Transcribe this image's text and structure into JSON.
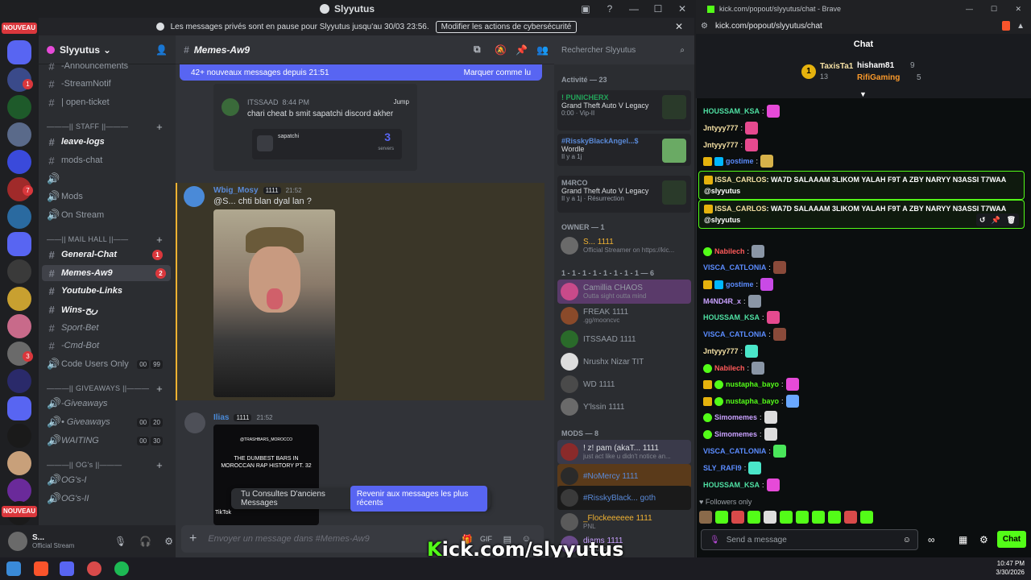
{
  "discord": {
    "window_title": "Slyyutus",
    "banner": {
      "text": "Les messages privés sont en pause pour Slyyutus jusqu'au 30/03 23:56.",
      "button": "Modifier les actions de cybersécurité"
    },
    "server_name": "Slyyutus",
    "guild_badges": {
      "new_top": "NOUVEAU",
      "new_bottom": "NOUVEAU"
    },
    "guild_counts": [
      "1",
      "7",
      "3"
    ],
    "channels": [
      {
        "label": "-Announcements",
        "type": "ch"
      },
      {
        "label": "-StreamNotif",
        "type": "ch"
      },
      {
        "label": "| open-ticket",
        "type": "ch"
      },
      {
        "label": "———|| STAFF ||———",
        "type": "cat"
      },
      {
        "label": "leave-logs",
        "type": "bold"
      },
      {
        "label": "mods-chat",
        "type": "ch"
      },
      {
        "label": "",
        "type": "ch"
      },
      {
        "label": "Mods",
        "type": "ch"
      },
      {
        "label": "On Stream",
        "type": "ch"
      },
      {
        "label": "——|| MAIL HALL ||——",
        "type": "cat"
      },
      {
        "label": "General-Chat",
        "type": "bold",
        "badge": "1"
      },
      {
        "label": "Memes-Aw9",
        "type": "bold",
        "badge": "2"
      },
      {
        "label": "Youtube-Links",
        "type": "bold"
      },
      {
        "label": "Wins-ربح",
        "type": "bold"
      },
      {
        "label": "Sport-Bet",
        "type": "ch"
      },
      {
        "label": "-Cmd-Bot",
        "type": "ch"
      },
      {
        "label": "Code Users Only",
        "type": "ch",
        "pills": [
          "00",
          "99"
        ]
      },
      {
        "label": "———|| GIVEAWAYS ||———",
        "type": "cat"
      },
      {
        "label": "-Giveaways",
        "type": "ch"
      },
      {
        "label": "• Giveaways",
        "type": "ch",
        "pills": [
          "00",
          "20"
        ]
      },
      {
        "label": "WAITING",
        "type": "ch",
        "pills": [
          "00",
          "30"
        ]
      },
      {
        "label": "———|| OG's ||———",
        "type": "cat"
      },
      {
        "label": "OG's-I",
        "type": "ch"
      },
      {
        "label": "OG's-II",
        "type": "ch"
      }
    ],
    "user": {
      "name": "S...",
      "status": "Official Stream"
    },
    "channel_name": "Memes-Aw9",
    "new_messages_bar": {
      "text": "42+ nouveaux messages depuis 21:51",
      "action": "Marquer comme lu"
    },
    "messages": [
      {
        "embed_user": "ITSSAAD",
        "embed_time": "8:44 PM",
        "embed_jump": "Jump",
        "embed_text": "chari cheat b smit sapatchi discord akher",
        "embed_inner_label": "sapatchi",
        "embed_inner_count": "3",
        "embed_inner_sub": "servers"
      },
      {
        "author": "Wbig_Mosy",
        "tag": "1111",
        "time": "21:52",
        "text": "@S... chti blan dyal lan ?"
      },
      {
        "author": "Ilias",
        "tag": "1111",
        "time": "21:52",
        "video_caption_top": "@TRASHBARS_MOROCCO",
        "video_caption": "THE DUMBEST BARS IN MOROCCAN RAP HISTORY PT. 32",
        "video_brand": "TikTok"
      }
    ],
    "old_messages": {
      "text": "Tu Consultes D'anciens Messages",
      "action": "Revenir aux messages les plus récents"
    },
    "input_placeholder": "Envoyer un message dans #Memes-Aw9",
    "members": {
      "search_placeholder": "Rechercher Slyyutus",
      "activity_header": "Activité — 23",
      "activities": [
        {
          "who": "! PUNICHERX",
          "game": "Grand Theft Auto V Legacy",
          "meta": "0:00 · Vip-II"
        },
        {
          "who": "#RisskyBlackAngel...$",
          "game": "Wordle",
          "meta": "Il y a 1j"
        },
        {
          "who": "M4RCO",
          "game": "Grand Theft Auto V Legacy",
          "meta": "Il y a 1j · Résurrection"
        }
      ],
      "owner_header": "OWNER — 1",
      "owner": {
        "name": "S...",
        "tag": "1111",
        "sub": "Official Streamer on https://kic..."
      },
      "group_header": "1 - 1 - 1 - 1 - 1 - 1 - 1 - 1 — 6",
      "group": [
        {
          "name": "Camillia",
          "tag": "CHAOS",
          "sub": "Outta sight outta mind"
        },
        {
          "name": "FREAK",
          "tag": "1111",
          "sub": ".gg/mooncvc"
        },
        {
          "name": "ITSSAAD",
          "tag": "1111",
          "sub": ""
        },
        {
          "name": "Nrushx Nizar",
          "tag": "TIT",
          "sub": ""
        },
        {
          "name": "WD",
          "tag": "1111",
          "sub": ""
        },
        {
          "name": "Y'lssin",
          "tag": "1111",
          "sub": ""
        }
      ],
      "mods_header": "MODS — 8",
      "mods": [
        {
          "name": "! z! pam (akaT...",
          "tag": "1111",
          "sub": "just act like u didn't notice an..."
        },
        {
          "name": "#NoMercy",
          "tag": "1111",
          "sub": ""
        },
        {
          "name": "#RisskyBlack...",
          "tag": "goth",
          "sub": ""
        },
        {
          "name": "_Flockeeeeee",
          "tag": "1111",
          "sub": "PNL"
        },
        {
          "name": "diams",
          "tag": "1111",
          "sub": "Wasupp!!!"
        }
      ]
    }
  },
  "kick": {
    "tab_title": "kick.com/popout/slyyutus/chat - Brave",
    "url": "kick.com/popout/slyyutus/chat",
    "header": "Chat",
    "gifters": [
      {
        "rank": "1",
        "name": "TaxisTa1",
        "count": "13"
      },
      {
        "name": "hisham81",
        "count": "9"
      },
      {
        "name": "RifiGaming",
        "count": "5"
      }
    ],
    "messages": [
      {
        "user": "HOUSSAM_KSA",
        "color": "#4fe0a3",
        "badges": [],
        "text": "",
        "emote": "#e64ad8"
      },
      {
        "user": "Jntyyy777",
        "color": "#f5e1a4",
        "badges": [],
        "text": "",
        "emote": "#e64a8f"
      },
      {
        "user": "Jntyyy777",
        "color": "#f5e1a4",
        "badges": [],
        "text": "",
        "emote": "#e64a8f"
      },
      {
        "user": "gostime",
        "color": "#5b8cff",
        "badges": [
          "crown",
          "mod"
        ],
        "text": "",
        "emote": "#d7b24a"
      },
      {
        "user": "Nabilech",
        "color": "#ff5a5a",
        "badges": [
          "bolt"
        ],
        "text": "",
        "emote": "#8a96a6"
      },
      {
        "user": "VISCA_CATLONIA",
        "color": "#5b8cff",
        "badges": [],
        "text": "",
        "emote": "#8a4a3a"
      },
      {
        "user": "gostime",
        "color": "#5b8cff",
        "badges": [
          "crown",
          "mod"
        ],
        "text": "",
        "emote": "#c94ae6"
      },
      {
        "user": "M4ND4R_x",
        "color": "#c9a1ff",
        "badges": [],
        "text": "",
        "emote": "#8a96a6"
      },
      {
        "user": "HOUSSAM_KSA",
        "color": "#4fe0a3",
        "badges": [],
        "text": "",
        "emote": "#e64a8f"
      },
      {
        "user": "VISCA_CATLONIA",
        "color": "#5b8cff",
        "badges": [],
        "text": "",
        "emote": "#8a4a3a"
      },
      {
        "user": "Jntyyy777",
        "color": "#f5e1a4",
        "badges": [],
        "text": "",
        "emote": "#4ae6c9"
      },
      {
        "user": "Nabilech",
        "color": "#ff5a5a",
        "badges": [
          "bolt"
        ],
        "text": "",
        "emote": "#8a96a6"
      },
      {
        "user": "nustapha_bayo",
        "color": "#53fc18",
        "badges": [
          "crown",
          "bolt"
        ],
        "text": "",
        "emote": "#e64ad8"
      },
      {
        "user": "nustapha_bayo",
        "color": "#53fc18",
        "badges": [
          "crown",
          "bolt"
        ],
        "text": "",
        "emote": "#6aa8ff"
      },
      {
        "user": "Simomemes",
        "color": "#c9a1ff",
        "badges": [
          "bolt"
        ],
        "text": "",
        "emote": "#dddddd"
      },
      {
        "user": "Simomemes",
        "color": "#c9a1ff",
        "badges": [
          "bolt"
        ],
        "text": "",
        "emote": "#dddddd"
      },
      {
        "user": "VISCA_CATLONIA",
        "color": "#5b8cff",
        "badges": [],
        "text": "",
        "emote": "#4ae65a"
      },
      {
        "user": "SLY_RAFI9",
        "color": "#5b8cff",
        "badges": [],
        "text": "",
        "emote": "#4ae6c9"
      },
      {
        "user": "HOUSSAM_KSA",
        "color": "#4fe0a3",
        "badges": [],
        "text": "",
        "emote": "#e64ad8"
      }
    ],
    "highlight": {
      "user": "ISSA_CARLOS",
      "text": "WA7D SALAAAM 3LIKOM YALAH F9T A ZBY NARYY N3ASSI T7WAA",
      "mention": "@slyyutus"
    },
    "followers_only": "Followers only",
    "input_placeholder": "Send a message",
    "chat_button": "Chat"
  },
  "overlay": {
    "k": "K",
    "text": "ick.com/slyyutus"
  },
  "taskbar": {
    "time": "10:47 PM",
    "date": "3/30/2026"
  }
}
